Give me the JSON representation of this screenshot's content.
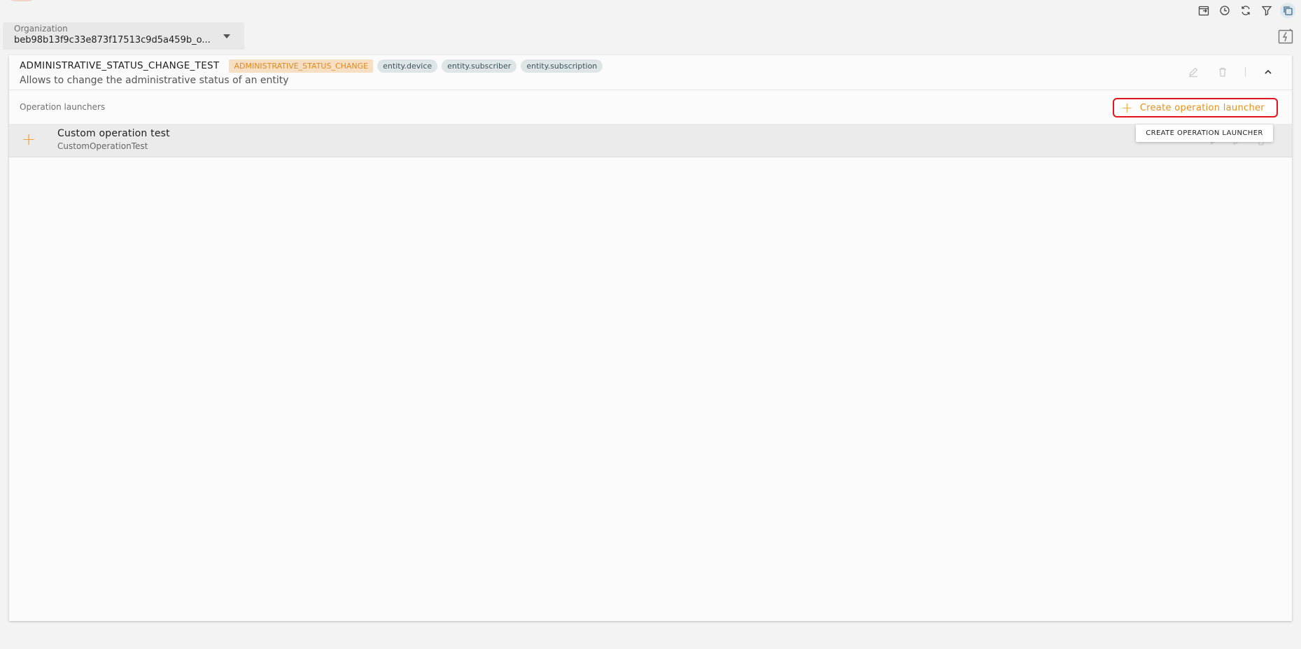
{
  "colors": {
    "accent_orange": "#e88f19",
    "highlight_red": "#e3141b",
    "tag_bg": "#dde5e6",
    "type_tag_bg": "#f7dfc4"
  },
  "toolbar": {
    "icons": [
      "calendar-export-icon",
      "history-icon",
      "refresh-icon",
      "filter-icon",
      "copy-icon"
    ]
  },
  "organization": {
    "label": "Organization",
    "value": "beb98b13f9c33e873f17513c9d5a459b_o..."
  },
  "operation": {
    "title": "ADMINISTRATIVE_STATUS_CHANGE_TEST",
    "type_tag": "ADMINISTRATIVE_STATUS_CHANGE",
    "entity_tags": [
      "entity.device",
      "entity.subscriber",
      "entity.subscription"
    ],
    "description": "Allows to change the administrative status of an entity"
  },
  "launchers": {
    "section_label": "Operation launchers",
    "create_button_label": "Create operation launcher",
    "tooltip": "CREATE OPERATION LAUNCHER",
    "items": [
      {
        "name": "Custom operation test",
        "id": "CustomOperationTest"
      }
    ]
  }
}
